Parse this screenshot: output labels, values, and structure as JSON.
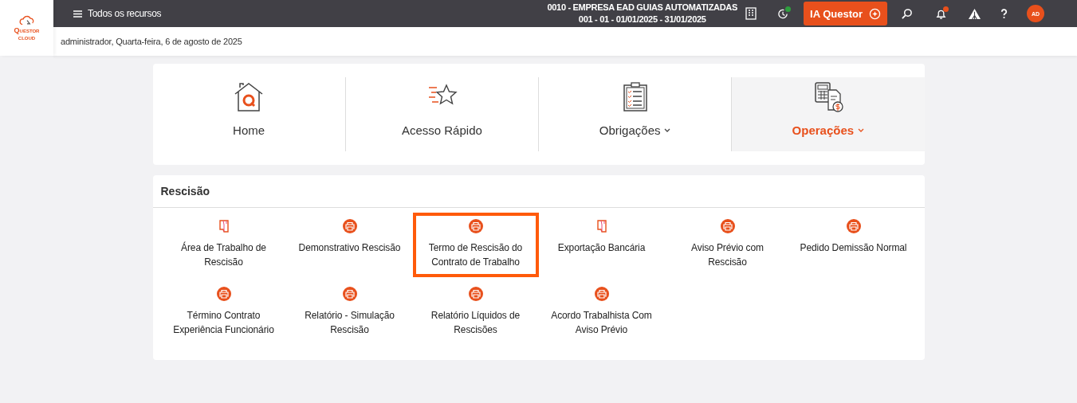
{
  "logo": {
    "line1": "Questor",
    "line2": "cloud"
  },
  "topbar": {
    "menu_label": "Todos os recursos",
    "company": "0010 - EMPRESA EAD GUIAS AUTOMATIZADAS",
    "period": "001 - 01 - 01/01/2025 - 31/01/2025",
    "ai_button": "IA Questor",
    "avatar": "AD",
    "notification": true
  },
  "greeting": "administrador, Quarta-feira, 6 de agosto de 2025",
  "nav_tabs": [
    {
      "label": "Home",
      "has_menu": false,
      "selected": false
    },
    {
      "label": "Acesso Rápido",
      "has_menu": false,
      "selected": false
    },
    {
      "label": "Obrigações",
      "has_menu": true,
      "selected": false
    },
    {
      "label": "Operações",
      "has_menu": true,
      "selected": true
    }
  ],
  "section": {
    "title": "Rescisão",
    "items": [
      {
        "label": "Área de Trabalho de Rescisão",
        "kind": "folder",
        "highlighted": false
      },
      {
        "label": "Demonstrativo Rescisão",
        "kind": "printer",
        "highlighted": false
      },
      {
        "label": "Termo de Rescisão do Contrato de Trabalho",
        "kind": "printer",
        "highlighted": true
      },
      {
        "label": "Exportação Bancária",
        "kind": "folder",
        "highlighted": false
      },
      {
        "label": "Aviso Prévio com Rescisão",
        "kind": "printer",
        "highlighted": false
      },
      {
        "label": "Pedido Demissão Normal",
        "kind": "printer",
        "highlighted": false
      },
      {
        "label": "Término Contrato Experiência Funcionário",
        "kind": "printer",
        "highlighted": false
      },
      {
        "label": "Relatório - Simulação Rescisão",
        "kind": "printer",
        "highlighted": false
      },
      {
        "label": "Relatório Líquidos de Rescisões",
        "kind": "printer",
        "highlighted": false
      },
      {
        "label": "Acordo Trabalhista Com Aviso Prévio",
        "kind": "printer",
        "highlighted": false
      }
    ]
  }
}
